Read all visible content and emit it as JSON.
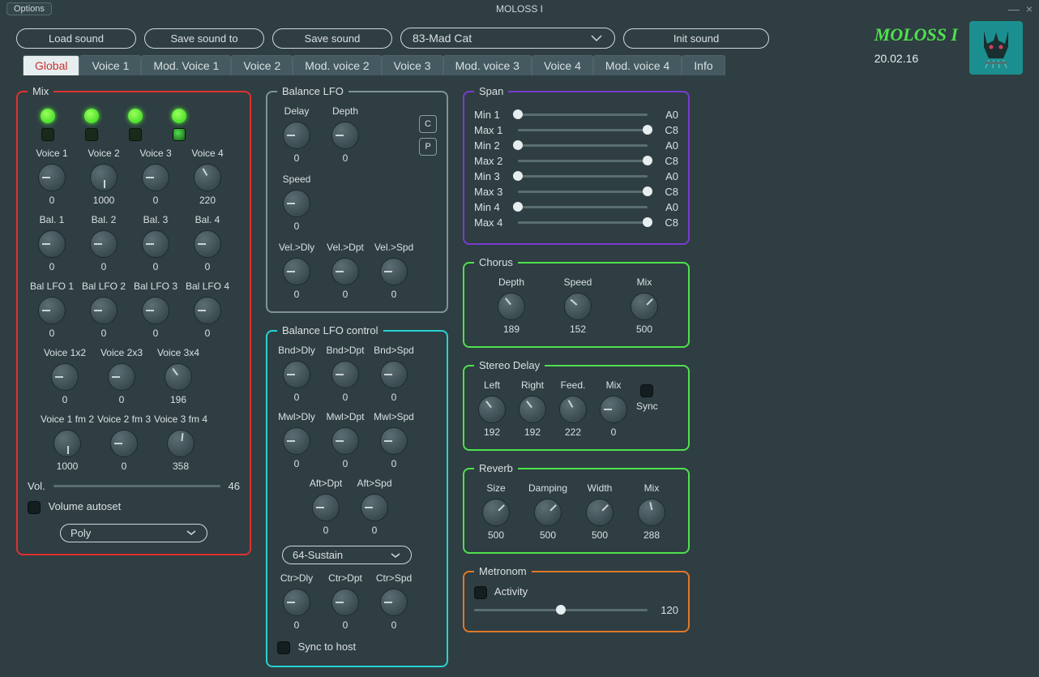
{
  "titlebar": {
    "options": "Options",
    "title": "MOLOSS I"
  },
  "topbar": {
    "load": "Load sound",
    "saveTo": "Save sound to",
    "save": "Save sound",
    "preset": "83-Mad Cat",
    "init": "Init sound"
  },
  "brand": {
    "title": "MOLOSS I",
    "date": "20.02.16"
  },
  "tabs": [
    "Global",
    "Voice 1",
    "Mod. Voice 1",
    "Voice 2",
    "Mod. voice 2",
    "Voice 3",
    "Mod. voice 3",
    "Voice 4",
    "Mod. voice 4",
    "Info"
  ],
  "mix": {
    "legend": "Mix",
    "voice": {
      "labels": [
        "Voice 1",
        "Voice 2",
        "Voice 3",
        "Voice 4"
      ],
      "vals": [
        "0",
        "1000",
        "0",
        "220"
      ]
    },
    "bal": {
      "labels": [
        "Bal. 1",
        "Bal. 2",
        "Bal. 3",
        "Bal. 4"
      ],
      "vals": [
        "0",
        "0",
        "0",
        "0"
      ]
    },
    "blfo": {
      "labels": [
        "Bal LFO 1",
        "Bal LFO 2",
        "Bal LFO 3",
        "Bal LFO 4"
      ],
      "vals": [
        "0",
        "0",
        "0",
        "0"
      ]
    },
    "cross1": {
      "labels": [
        "Voice 1x2",
        "Voice 2x3",
        "Voice 3x4"
      ],
      "vals": [
        "0",
        "0",
        "196"
      ]
    },
    "cross2": {
      "labels": [
        "Voice 1 fm 2",
        "Voice 2 fm 3",
        "Voice 3 fm 4"
      ],
      "vals": [
        "1000",
        "0",
        "358"
      ]
    },
    "volLabel": "Vol.",
    "vol": "46",
    "autoset": "Volume autoset",
    "poly": "Poly"
  },
  "blfo": {
    "legend": "Balance LFO",
    "row1": {
      "labels": [
        "Delay",
        "Depth",
        "Speed"
      ],
      "vals": [
        "0",
        "0",
        "0"
      ]
    },
    "row2": {
      "labels": [
        "Vel.>Dly",
        "Vel.>Dpt",
        "Vel.>Spd"
      ],
      "vals": [
        "0",
        "0",
        "0"
      ]
    },
    "c": "C",
    "p": "P"
  },
  "blfoc": {
    "legend": "Balance LFO control",
    "r1": {
      "labels": [
        "Bnd>Dly",
        "Bnd>Dpt",
        "Bnd>Spd"
      ],
      "vals": [
        "0",
        "0",
        "0"
      ]
    },
    "r2": {
      "labels": [
        "Mwl>Dly",
        "Mwl>Dpt",
        "Mwl>Spd"
      ],
      "vals": [
        "0",
        "0",
        "0"
      ]
    },
    "r3": {
      "labels": [
        "Aft>Dpt",
        "Aft>Spd"
      ],
      "vals": [
        "0",
        "0"
      ]
    },
    "ctrl": "64-Sustain",
    "r4": {
      "labels": [
        "Ctr>Dly",
        "Ctr>Dpt",
        "Ctr>Spd"
      ],
      "vals": [
        "0",
        "0",
        "0"
      ]
    },
    "sync": "Sync to host"
  },
  "span": {
    "legend": "Span",
    "rows": [
      {
        "lab": "Min 1",
        "pos": 0,
        "val": "A0"
      },
      {
        "lab": "Max 1",
        "pos": 100,
        "val": "C8"
      },
      {
        "lab": "Min 2",
        "pos": 0,
        "val": "A0"
      },
      {
        "lab": "Max 2",
        "pos": 100,
        "val": "C8"
      },
      {
        "lab": "Min 3",
        "pos": 0,
        "val": "A0"
      },
      {
        "lab": "Max 3",
        "pos": 100,
        "val": "C8"
      },
      {
        "lab": "Min 4",
        "pos": 0,
        "val": "A0"
      },
      {
        "lab": "Max 4",
        "pos": 100,
        "val": "C8"
      }
    ]
  },
  "chorus": {
    "legend": "Chorus",
    "labels": [
      "Depth",
      "Speed",
      "Mix"
    ],
    "vals": [
      "189",
      "152",
      "500"
    ]
  },
  "delay": {
    "legend": "Stereo Delay",
    "labels": [
      "Left",
      "Right",
      "Feed.",
      "Mix"
    ],
    "vals": [
      "192",
      "192",
      "222",
      "0"
    ],
    "sync": "Sync"
  },
  "reverb": {
    "legend": "Reverb",
    "labels": [
      "Size",
      "Damping",
      "Width",
      "Mix"
    ],
    "vals": [
      "500",
      "500",
      "500",
      "288"
    ]
  },
  "metro": {
    "legend": "Metronom",
    "activity": "Activity",
    "val": "120"
  }
}
